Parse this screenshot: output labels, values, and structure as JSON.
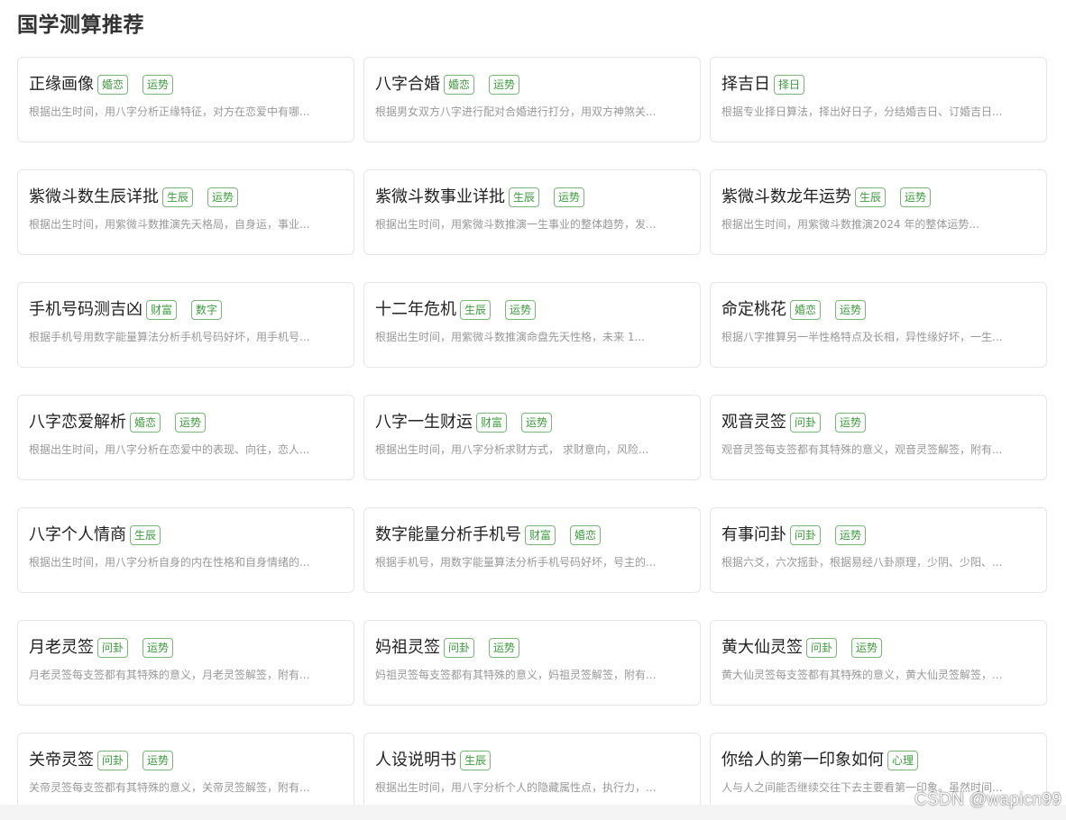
{
  "section": {
    "title": "国学测算推荐"
  },
  "watermark": "CSDN @wapicn99",
  "cards": [
    {
      "title": "正缘画像",
      "tags": [
        "婚恋",
        "运势"
      ],
      "desc": "根据出生时间，用八字分析正缘特征，对方在恋爱中有哪..."
    },
    {
      "title": "八字合婚",
      "tags": [
        "婚恋",
        "运势"
      ],
      "desc": "根据男女双方八字进行配对合婚进行打分，用双方神煞关..."
    },
    {
      "title": "择吉日",
      "tags": [
        "择日"
      ],
      "desc": "根据专业择日算法，择出好日子，分结婚吉日、订婚吉日..."
    },
    {
      "title": "紫微斗数生辰详批",
      "tags": [
        "生辰",
        "运势"
      ],
      "desc": "根据出生时间，用紫微斗数推演先天格局，自身运，事业..."
    },
    {
      "title": "紫微斗数事业详批",
      "tags": [
        "生辰",
        "运势"
      ],
      "desc": "根据出生时间，用紫微斗数推演一生事业的整体趋势，发..."
    },
    {
      "title": "紫微斗数龙年运势",
      "tags": [
        "生辰",
        "运势"
      ],
      "desc": "根据出生时间，用紫微斗数推演2024 年的整体运势..."
    },
    {
      "title": "手机号码测吉凶",
      "tags": [
        "财富",
        "数字"
      ],
      "desc": "根据手机号用数字能量算法分析手机号码好坏，用手机号..."
    },
    {
      "title": "十二年危机",
      "tags": [
        "生辰",
        "运势"
      ],
      "desc": "根据出生时间，用紫微斗数推演命盘先天性格，未来 1..."
    },
    {
      "title": "命定桃花",
      "tags": [
        "婚恋",
        "运势"
      ],
      "desc": "根据八字推算另一半性格特点及长相，异性缘好坏，一生..."
    },
    {
      "title": "八字恋爱解析",
      "tags": [
        "婚恋",
        "运势"
      ],
      "desc": "根据出生时间，用八字分析在恋爱中的表现、向往，恋人..."
    },
    {
      "title": "八字一生财运",
      "tags": [
        "财富",
        "运势"
      ],
      "desc": "根据出生时间，用八字分析求财方式， 求财意向，风险..."
    },
    {
      "title": "观音灵签",
      "tags": [
        "问卦",
        "运势"
      ],
      "desc": "观音灵签每支签都有其特殊的意义，观音灵签解签，附有..."
    },
    {
      "title": "八字个人情商",
      "tags": [
        "生辰"
      ],
      "desc": "根据出生时间，用八字分析自身的内在性格和自身情绪的..."
    },
    {
      "title": "数字能量分析手机号",
      "tags": [
        "财富",
        "婚恋"
      ],
      "desc": "根据手机号，用数字能量算法分析手机号码好坏，号主的..."
    },
    {
      "title": "有事问卦",
      "tags": [
        "问卦",
        "运势"
      ],
      "desc": "根据六爻，六次摇卦，根据易经八卦原理，少阴、少阳、..."
    },
    {
      "title": "月老灵签",
      "tags": [
        "问卦",
        "运势"
      ],
      "desc": "月老灵签每支签都有其特殊的意义，月老灵签解签，附有..."
    },
    {
      "title": "妈祖灵签",
      "tags": [
        "问卦",
        "运势"
      ],
      "desc": "妈祖灵签每支签都有其特殊的意义，妈祖灵签解签，附有..."
    },
    {
      "title": "黄大仙灵签",
      "tags": [
        "问卦",
        "运势"
      ],
      "desc": "黄大仙灵签每支签都有其特殊的意义，黄大仙灵签解签，..."
    },
    {
      "title": "关帝灵签",
      "tags": [
        "问卦",
        "运势"
      ],
      "desc": "关帝灵签每支签都有其特殊的意义，关帝灵签解签，附有..."
    },
    {
      "title": "人设说明书",
      "tags": [
        "生辰"
      ],
      "desc": "根据出生时间，用八字分析个人的隐藏属性点，执行力，..."
    },
    {
      "title": "你给人的第一印象如何",
      "tags": [
        "心理"
      ],
      "desc": "人与人之间能否继续交往下去主要看第一印象。虽然时间..."
    }
  ]
}
